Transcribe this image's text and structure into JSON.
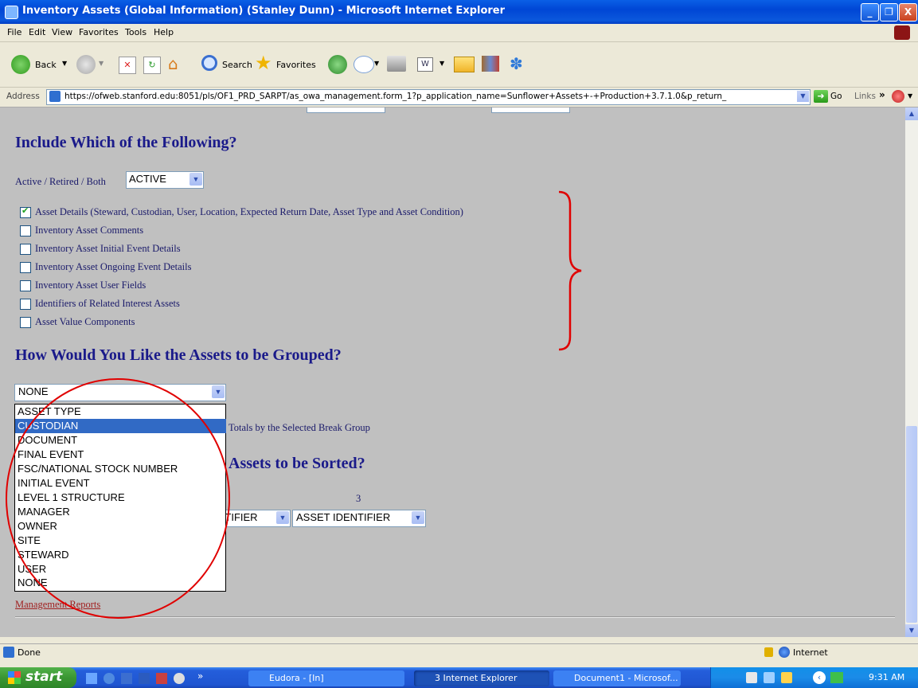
{
  "window": {
    "title": "Inventory Assets (Global Information) (Stanley Dunn) - Microsoft Internet Explorer",
    "controls": [
      "_",
      "❐",
      "X"
    ]
  },
  "menubar": {
    "items": [
      "File",
      "Edit",
      "View",
      "Favorites",
      "Tools",
      "Help"
    ]
  },
  "toolbar": {
    "back_label": "Back",
    "search_label": "Search",
    "favorites_label": "Favorites"
  },
  "address": {
    "label": "Address",
    "url": "https://ofweb.stanford.edu:8051/pls/OF1_PRD_SARPT/as_owa_management.form_1?p_application_name=Sunflower+Assets+-+Production+3.7.1.0&p_return_",
    "go_label": "Go",
    "links_label": "Links"
  },
  "include_section": {
    "heading": "Include Which of the Following?",
    "status_label": "Active / Retired / Both",
    "status_value": "ACTIVE",
    "options": [
      {
        "label": "Asset Details (Steward, Custodian, User, Location, Expected Return Date, Asset Type and Asset Condition)",
        "checked": true
      },
      {
        "label": "Inventory Asset Comments",
        "checked": false
      },
      {
        "label": "Inventory Asset Initial Event Details",
        "checked": false
      },
      {
        "label": "Inventory Asset Ongoing Event Details",
        "checked": false
      },
      {
        "label": "Inventory Asset User Fields",
        "checked": false
      },
      {
        "label": "Identifiers of Related Interest Assets",
        "checked": false
      },
      {
        "label": "Asset Value Components",
        "checked": false
      }
    ]
  },
  "group_section": {
    "heading": "How Would You Like the Assets to be Grouped?",
    "selected_value": "NONE",
    "totals_label": "Totals by the Selected Break Group",
    "dropdown_options": [
      "ASSET TYPE",
      "CUSTODIAN",
      "DOCUMENT",
      "FINAL EVENT",
      "FSC/NATIONAL STOCK NUMBER",
      "INITIAL EVENT",
      "LEVEL 1 STRUCTURE",
      "MANAGER",
      "OWNER",
      "SITE",
      "STEWARD",
      "USER",
      "NONE"
    ],
    "highlighted_option": "CUSTODIAN"
  },
  "sort_section": {
    "heading_visible": "Assets to be Sorted?",
    "column_3_label": "3",
    "select_2_value": "ASSET IDENTIFIER",
    "select_2_visible": "NTIFIER",
    "select_3_value": "ASSET IDENTIFIER"
  },
  "footer_link": "Management Reports",
  "statusbar": {
    "status_text": "Done",
    "zone_text": "Internet"
  },
  "taskbar": {
    "start_label": "start",
    "tasks": [
      "Eudora - [In]",
      "3 Internet Explorer",
      "Document1 - Microsof..."
    ],
    "clock": "9:31 AM"
  },
  "colors": {
    "annotation_red": "#e00000",
    "heading_blue": "#1a1a8a",
    "selection_blue": "#316ac5"
  }
}
